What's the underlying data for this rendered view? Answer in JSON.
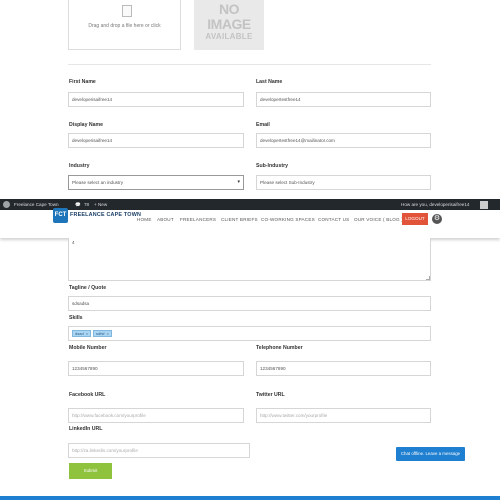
{
  "upload": {
    "dropzone_text": "Drag and drop a file here or click",
    "placeholder_image": {
      "line1": "NO",
      "line2": "IMAGE",
      "line3": "AVAILABLE"
    }
  },
  "form": {
    "first_name": {
      "label": "First Name",
      "value": "developerisaifree14"
    },
    "last_name": {
      "label": "Last Name",
      "value": "developertestfree14"
    },
    "display_name": {
      "label": "Display Name",
      "value": "developerisaifree14"
    },
    "email": {
      "label": "Email",
      "value": "developertestfree14@mailinator.com"
    },
    "industry": {
      "label": "Industry",
      "value": "Please select an industry"
    },
    "sub_industry": {
      "label": "Sub-Industry",
      "value": "Please select Sub-Industry"
    },
    "bio_value": "4",
    "tagline": {
      "label": "Tagline / Quote",
      "value": "sdsadsa"
    },
    "skills": {
      "label": "Skills",
      "tags": [
        "dsad",
        "sdfsf"
      ]
    },
    "mobile": {
      "label": "Mobile Number",
      "value": "1234567890"
    },
    "telephone": {
      "label": "Telephone Number",
      "value": "1234567890"
    },
    "facebook": {
      "label": "Facebook URL",
      "placeholder": "http://www.facebook.com/yourprofile"
    },
    "twitter": {
      "label": "Twitter URL",
      "placeholder": "http://www.twitter.com/yourprofile"
    },
    "linkedin": {
      "label": "LinkedIn URL",
      "placeholder": "http://za.linkedin.com/yourprofile"
    },
    "submit_label": "Submit"
  },
  "admin_bar": {
    "site_name": "Freelance Cape Town",
    "comments_count": "78",
    "new_label": "+ New",
    "greeting": "How are you, developerisaifree14"
  },
  "header": {
    "logo_badge": "FCT",
    "logo_text": "FREELANCE CAPE TOWN",
    "nav": [
      "HOME",
      "ABOUT",
      "FREELANCERS",
      "CLIENT BRIEFS",
      "CO-WORKING SPACES",
      "CONTACT US",
      "OUR VOICE ( BLOG )"
    ],
    "logout_label": "LOGOUT"
  },
  "chat": {
    "label": "Chat offline. Leave a message"
  },
  "colors": {
    "accent_blue": "#1f7fd0",
    "logout_red": "#e2543a",
    "submit_green": "#8fc23d",
    "admin_bar": "#23282d"
  },
  "icons": {
    "wordpress": "wordpress-icon",
    "comments": "comment-icon",
    "settings": "gear-icon",
    "upload": "file-icon"
  }
}
